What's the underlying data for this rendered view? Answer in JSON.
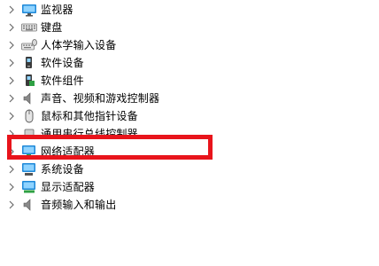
{
  "tree": {
    "items": [
      {
        "label": "监视器",
        "icon": "monitor-icon"
      },
      {
        "label": "键盘",
        "icon": "keyboard-icon"
      },
      {
        "label": "人体学输入设备",
        "icon": "hid-icon"
      },
      {
        "label": "软件设备",
        "icon": "software-device-icon"
      },
      {
        "label": "软件组件",
        "icon": "software-component-icon"
      },
      {
        "label": "声音、视频和游戏控制器",
        "icon": "speaker-icon"
      },
      {
        "label": "鼠标和其他指针设备",
        "icon": "mouse-icon"
      },
      {
        "label": "通用串行总线控制器",
        "icon": "usb-icon"
      },
      {
        "label": "网络适配器",
        "icon": "network-adapter-icon"
      },
      {
        "label": "系统设备",
        "icon": "system-device-icon"
      },
      {
        "label": "显示适配器",
        "icon": "display-adapter-icon"
      },
      {
        "label": "音频输入和输出",
        "icon": "audio-io-icon"
      }
    ]
  },
  "highlight": {
    "color": "#e8141b",
    "target": "网络适配器"
  }
}
